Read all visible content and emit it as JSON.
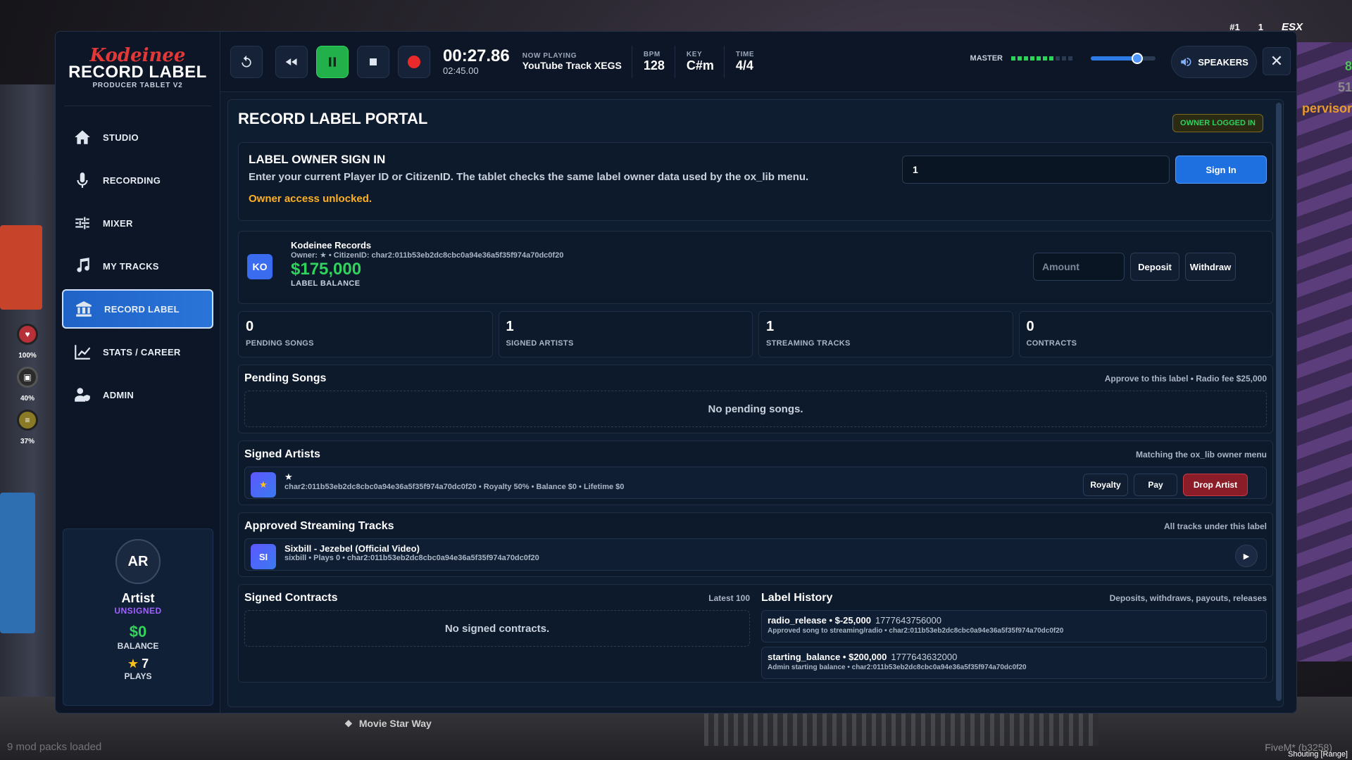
{
  "hud": {
    "top_items": [
      "#1",
      "1"
    ],
    "esx": "ESX",
    "right_lines": [
      "8",
      "51",
      "pervisor"
    ],
    "status": [
      {
        "label": "100%",
        "icon": "heart-icon"
      },
      {
        "label": "40%",
        "icon": "armor-icon"
      },
      {
        "label": "37%",
        "icon": "food-icon"
      }
    ],
    "street": "Movie Star Way",
    "modpacks": "9 mod packs loaded",
    "fivem": "FiveM* (b3258)",
    "shouting": "Shouting [Range]"
  },
  "brand": {
    "script": "Kodeinee",
    "title": "RECORD LABEL",
    "subtitle": "PRODUCER TABLET V2"
  },
  "nav": [
    {
      "label": "STUDIO",
      "icon": "home-icon"
    },
    {
      "label": "RECORDING",
      "icon": "microphone-icon"
    },
    {
      "label": "MIXER",
      "icon": "sliders-icon"
    },
    {
      "label": "MY TRACKS",
      "icon": "music-note-icon"
    },
    {
      "label": "RECORD LABEL",
      "icon": "bank-icon",
      "active": true
    },
    {
      "label": "STATS / CAREER",
      "icon": "chart-icon"
    },
    {
      "label": "ADMIN",
      "icon": "admin-user-icon"
    }
  ],
  "profile": {
    "initials": "AR",
    "name": "Artist",
    "status": "UNSIGNED",
    "balance": "$0",
    "balance_label": "BALANCE",
    "plays": "7",
    "plays_label": "PLAYS"
  },
  "transport": {
    "elapsed": "00:27.86",
    "duration": "02:45.00",
    "now_playing_label": "NOW PLAYING",
    "now_playing": "YouTube Track XEGS",
    "bpm_label": "BPM",
    "bpm": "128",
    "key_label": "KEY",
    "key": "C#m",
    "time_label": "TIME",
    "time_sig": "4/4",
    "master_label": "MASTER",
    "master_meter_lit": 7,
    "master_meter_total": 10,
    "volume": 0.72,
    "speakers_label": "SPEAKERS",
    "close": "✕"
  },
  "portal": {
    "title": "RECORD LABEL PORTAL",
    "owner_badge": "OWNER LOGGED IN",
    "signin": {
      "heading": "LABEL OWNER SIGN IN",
      "desc": "Enter your current Player ID or CitizenID. The tablet checks the same label owner data used by the ox_lib menu.",
      "status": "Owner access unlocked.",
      "input_value": "1",
      "button": "Sign In"
    },
    "label": {
      "initials": "KO",
      "name": "Kodeinee Records",
      "owner": "Owner: ★ • CitizenID: char2:011b53eb2dc8cbc0a94e36a5f35f974a70dc0f20",
      "balance": "$175,000",
      "balance_label": "LABEL BALANCE",
      "amount_placeholder": "Amount",
      "deposit": "Deposit",
      "withdraw": "Withdraw"
    },
    "stats": [
      {
        "value": "0",
        "label": "PENDING SONGS"
      },
      {
        "value": "1",
        "label": "SIGNED ARTISTS"
      },
      {
        "value": "1",
        "label": "STREAMING TRACKS"
      },
      {
        "value": "0",
        "label": "CONTRACTS"
      }
    ],
    "pending": {
      "title": "Pending Songs",
      "note": "Approve to this label • Radio fee $25,000",
      "empty": "No pending songs."
    },
    "signed": {
      "title": "Signed Artists",
      "note": "Matching the ox_lib owner menu",
      "artist_name": "★",
      "artist_detail": "char2:011b53eb2dc8cbc0a94e36a5f35f974a70dc0f20 • Royalty 50% • Balance $0 • Lifetime $0",
      "royalty": "Royalty",
      "pay": "Pay",
      "drop": "Drop Artist"
    },
    "streaming": {
      "title": "Approved Streaming Tracks",
      "note": "All tracks under this label",
      "initials": "SI",
      "track": "Sixbill - Jezebel (Official Video)",
      "detail": "sixbill • Plays 0 • char2:011b53eb2dc8cbc0a94e36a5f35f974a70dc0f20"
    },
    "contracts": {
      "title": "Signed Contracts",
      "note": "Latest 100",
      "empty": "No signed contracts."
    },
    "history": {
      "title": "Label History",
      "note": "Deposits, withdraws, payouts, releases",
      "items": [
        {
          "head": "radio_release • $-25,000",
          "id": "1777643756000",
          "desc": "Approved song to streaming/radio • char2:011b53eb2dc8cbc0a94e36a5f35f974a70dc0f20"
        },
        {
          "head": "starting_balance • $200,000",
          "id": "1777643632000",
          "desc": "Admin starting balance • char2:011b53eb2dc8cbc0a94e36a5f35f974a70dc0f20"
        }
      ]
    }
  }
}
